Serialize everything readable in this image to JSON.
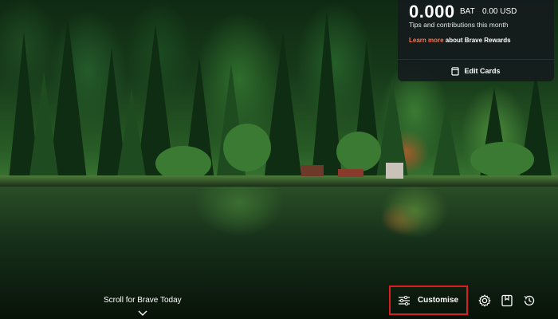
{
  "rewards": {
    "amount": "0.000",
    "unit": "BAT",
    "usd": "0.00 USD",
    "subtitle": "Tips and contributions this month",
    "learn_more": "Learn more",
    "learn_more_suffix": " about Brave Rewards",
    "edit_cards": "Edit Cards"
  },
  "bottom": {
    "scroll_label": "Scroll for Brave Today",
    "customise_label": "Customise"
  },
  "icons": [
    "settings-icon",
    "bookmarks-icon",
    "history-icon",
    "sliders-icon",
    "cards-icon",
    "chevron-down-icon"
  ],
  "colors": {
    "accent_link": "#ff7654",
    "highlight_border": "#d91f1f"
  }
}
